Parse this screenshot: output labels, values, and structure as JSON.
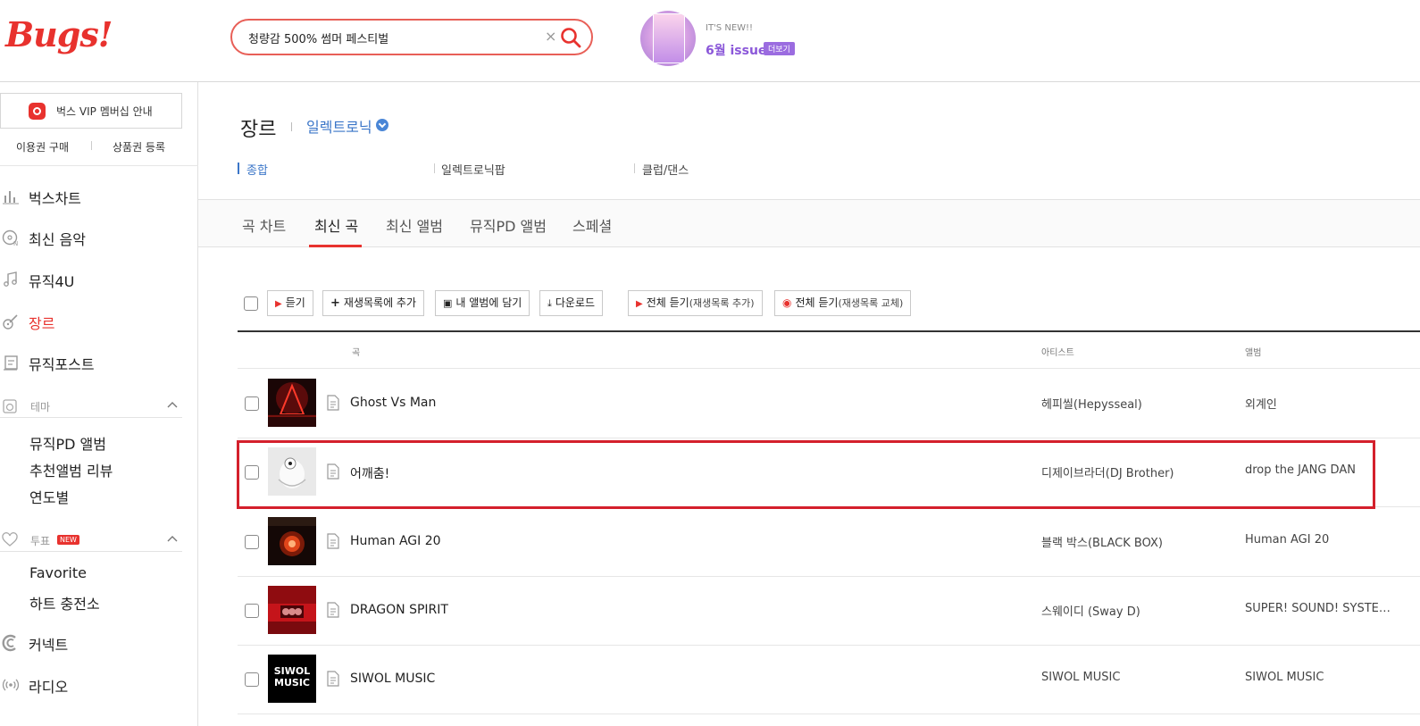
{
  "header": {
    "logo": "Bugs!",
    "search": {
      "value": "청량감 500% 썸머 페스티벌",
      "placeholder": ""
    },
    "issue": {
      "new_label": "IT'S NEW!!",
      "title": "6월 issue",
      "more": "더보기"
    }
  },
  "sidebar": {
    "vip": "벅스 VIP 멤버십 안내",
    "buy": "이용권 구매",
    "coupon": "상품권 등록",
    "nav": [
      {
        "label": "벅스차트",
        "icon": "chart-bars-icon"
      },
      {
        "label": "최신 음악",
        "icon": "disc-new-icon"
      },
      {
        "label": "뮤직4U",
        "icon": "music-note-icon"
      },
      {
        "label": "장르",
        "icon": "guitar-icon"
      },
      {
        "label": "뮤직포스트",
        "icon": "post-icon"
      }
    ],
    "theme": {
      "label": "테마",
      "items": [
        "뮤직PD 앨범",
        "추천앨범 리뷰",
        "연도별"
      ]
    },
    "vote": {
      "label": "투표",
      "badge": "NEW",
      "items": [
        "Favorite",
        "하트 충전소"
      ]
    },
    "bottom": [
      {
        "label": "커넥트",
        "icon": "connect-icon"
      },
      {
        "label": "라디오",
        "icon": "radio-icon"
      }
    ]
  },
  "main": {
    "genre_title": "장르",
    "genre_selected": "일렉트로닉",
    "subcategories": [
      "종합",
      "일렉트로닉팝",
      "클럽/댄스"
    ],
    "tabs": [
      "곡 차트",
      "최신 곡",
      "최신 앨범",
      "뮤직PD 앨범",
      "스페셜"
    ],
    "active_tab": "최신 곡",
    "toolbar": {
      "listen": "듣기",
      "add_playlist": "재생목록에 추가",
      "add_album": "내 앨범에 담기",
      "download": "다운로드",
      "play_all_add": "전체 듣기",
      "play_all_add_note": "(재생목록 추가)",
      "play_all_replace": "전체 듣기",
      "play_all_replace_note": "(재생목록 교체)"
    },
    "columns": {
      "song": "곡",
      "artist": "아티스트",
      "album": "앨범"
    },
    "rows": [
      {
        "title": "Ghost Vs Man",
        "artist": "헤피씰(Hepysseal)",
        "album": "외계인"
      },
      {
        "title": "어깨춤!",
        "artist": "디제이브라더(DJ Brother)",
        "album": "drop the JANG DAN"
      },
      {
        "title": "Human AGI 20",
        "artist": "블랙 박스(BLACK BOX)",
        "album": "Human AGI 20"
      },
      {
        "title": "DRAGON SPIRIT",
        "artist": "스웨이디 (Sway D)",
        "album": "SUPER! SOUND! SYSTE…"
      },
      {
        "title": "SIWOL MUSIC",
        "artist": "SIWOL MUSIC",
        "album": "SIWOL MUSIC"
      }
    ],
    "cover_text": {
      "siwol": "SIWOL MUSIC"
    }
  },
  "colors": {
    "brand_red": "#e8322e",
    "link_blue": "#3b76c8",
    "issue_purple": "#8b58d9",
    "highlight": "#d4202c"
  }
}
